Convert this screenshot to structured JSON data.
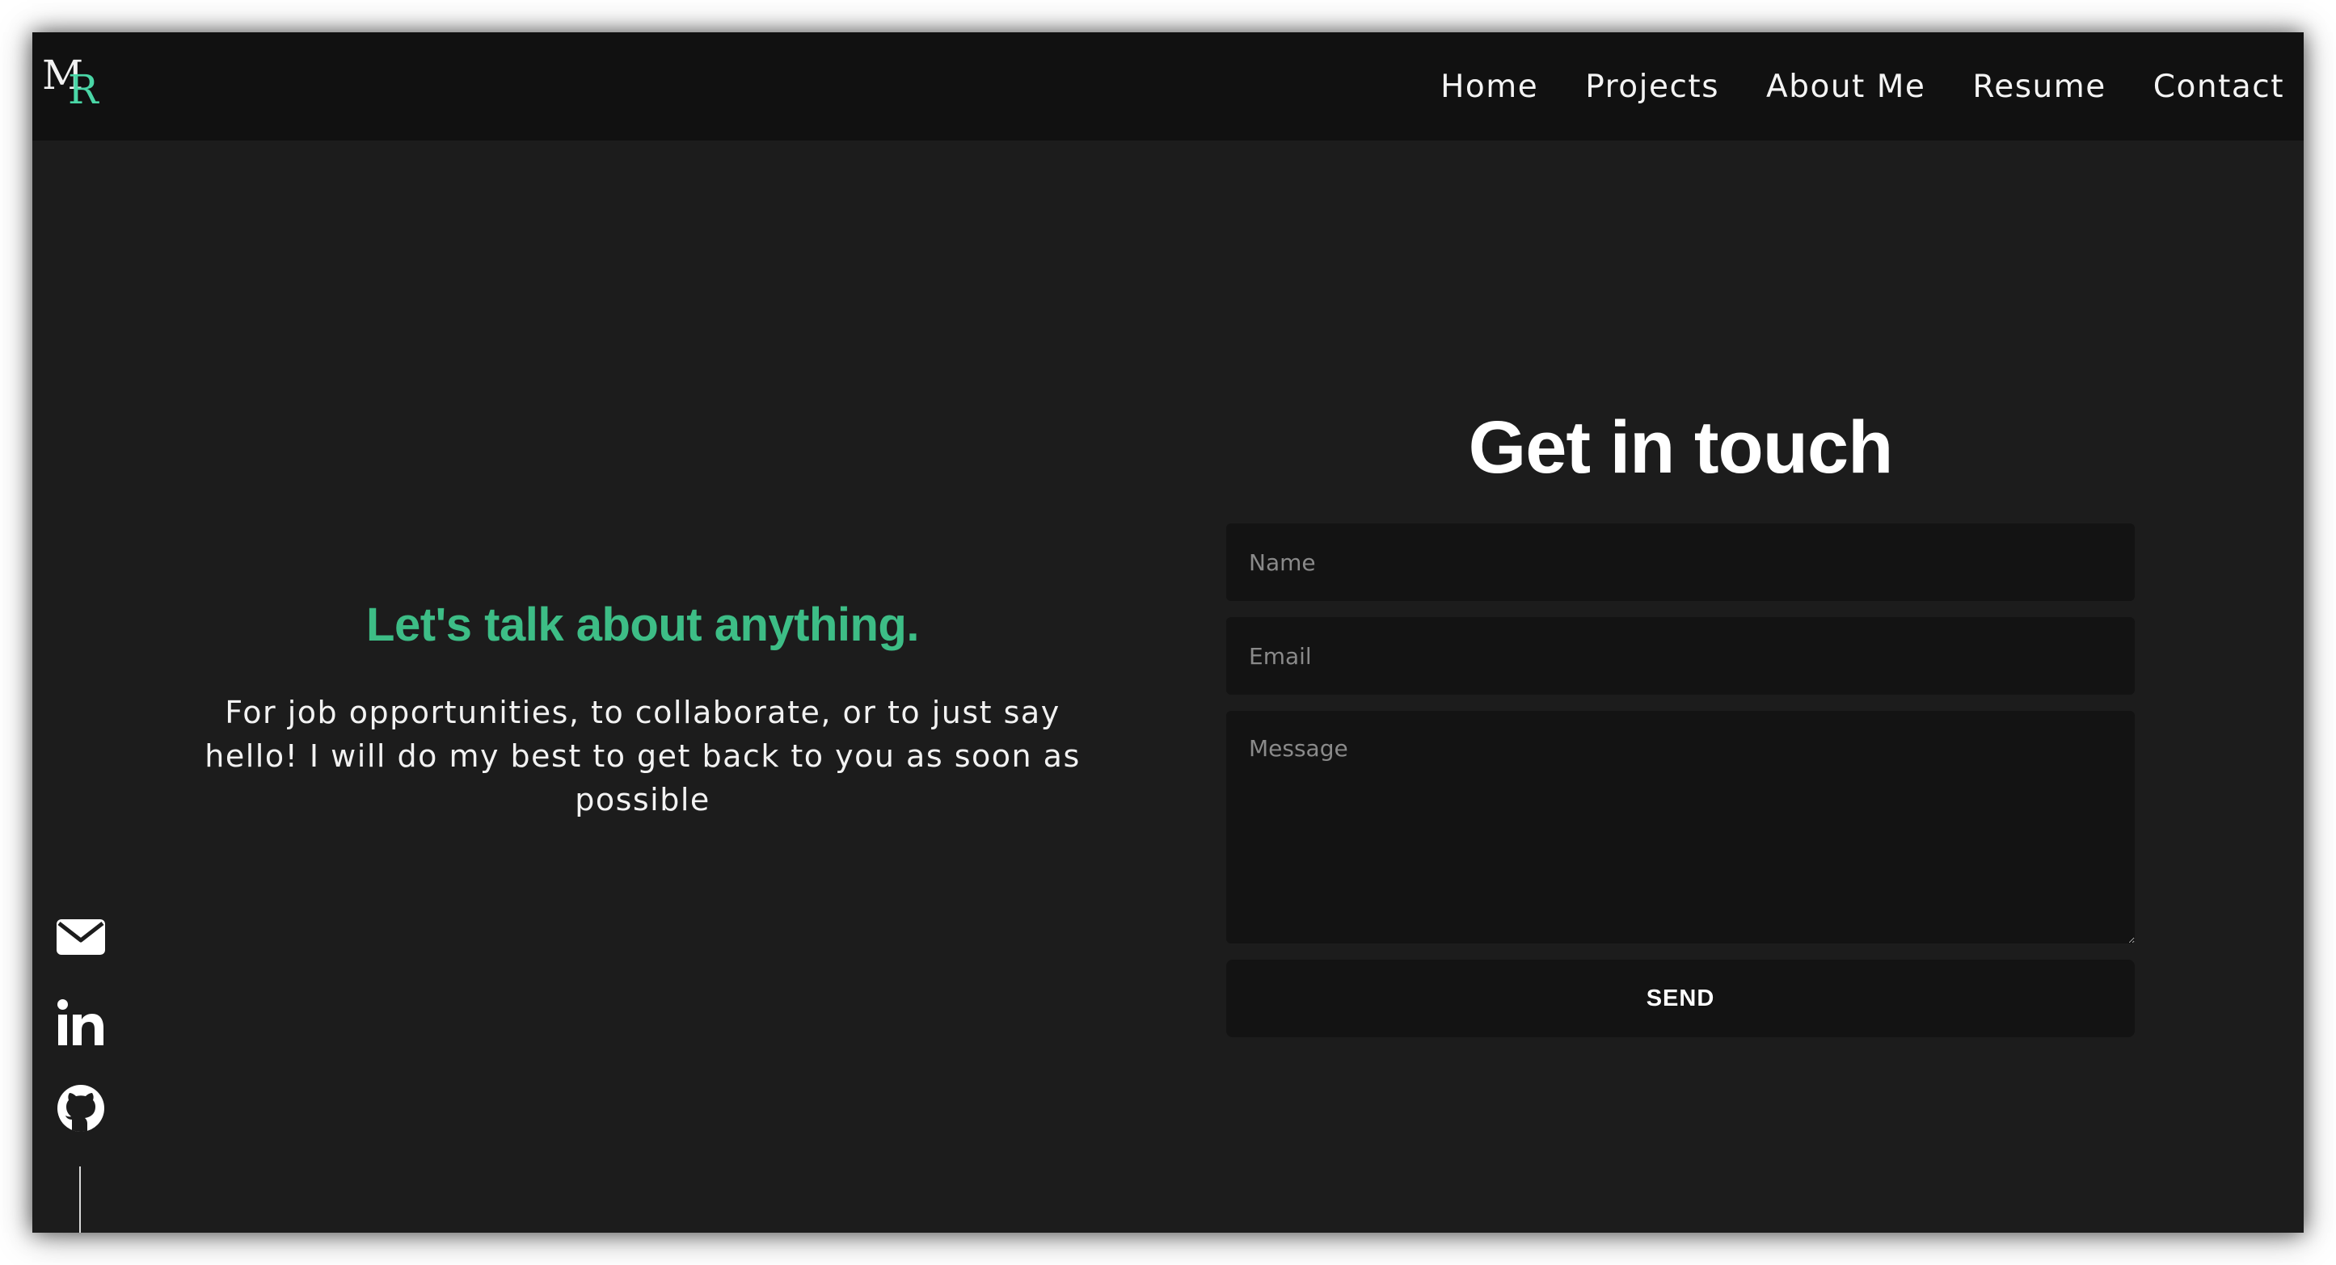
{
  "logo": {
    "first_letter": "M",
    "second_letter": "R",
    "accent_color": "#4ad6a6"
  },
  "nav": {
    "items": [
      {
        "label": "Home"
      },
      {
        "label": "Projects"
      },
      {
        "label": "About Me"
      },
      {
        "label": "Resume"
      },
      {
        "label": "Contact"
      }
    ]
  },
  "contact_intro": {
    "tagline": "Let's talk about anything.",
    "tagline_color": "#3dbd86",
    "body": "For job opportunities, to collaborate, or to just say hello! I will do my best to get back to you as soon as possible"
  },
  "form": {
    "title": "Get in touch",
    "name_placeholder": "Name",
    "name_value": "",
    "email_placeholder": "Email",
    "email_value": "",
    "message_placeholder": "Message",
    "message_value": "",
    "send_label": "SEND"
  },
  "socials": {
    "icons": [
      "envelope-icon",
      "linkedin-icon",
      "github-icon"
    ]
  },
  "colors": {
    "background": "#1c1c1c",
    "navbar": "#111111",
    "field": "#131313",
    "text": "#f2f2f2"
  }
}
